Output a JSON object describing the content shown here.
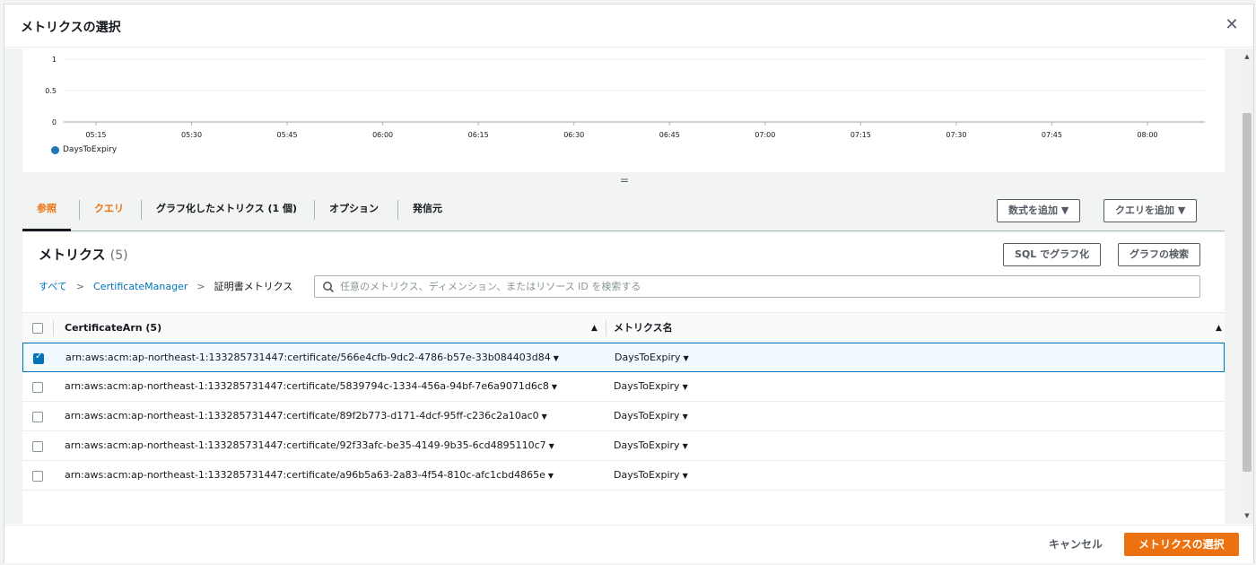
{
  "modal": {
    "title": "メトリクスの選択",
    "close_icon": "close-icon"
  },
  "chart_data": {
    "type": "line",
    "y_ticks": [
      "1",
      "0.5",
      "0"
    ],
    "ylim": [
      0,
      1
    ],
    "x_ticks": [
      "05:15",
      "05:30",
      "05:45",
      "06:00",
      "06:15",
      "06:30",
      "06:45",
      "07:00",
      "07:15",
      "07:30",
      "07:45",
      "08:00"
    ],
    "series": [
      {
        "name": "DaysToExpiry",
        "values": [],
        "color": "#1f77b4"
      }
    ],
    "grid": true,
    "legend": "bottom-left"
  },
  "resize_handle": "=",
  "tabs": [
    {
      "label": "参照",
      "active": true
    },
    {
      "label": "クエリ"
    },
    {
      "label": "グラフ化したメトリクス (1 個)"
    },
    {
      "label": "オプション"
    },
    {
      "label": "発信元"
    }
  ],
  "toolbar": {
    "add_formula": "数式を追加 ▼",
    "add_query": "クエリを追加 ▼"
  },
  "metrics": {
    "title": "メトリクス",
    "count": "(5)",
    "sql_button": "SQL でグラフ化",
    "graph_search_button": "グラフの検索"
  },
  "breadcrumb": {
    "all": "すべて",
    "namespace": "CertificateManager",
    "current": "証明書メトリクス",
    "separator": ">"
  },
  "search": {
    "placeholder": "任意のメトリクス、ディメンション、またはリソース ID を検索する",
    "value": ""
  },
  "table": {
    "columns": [
      {
        "label": "CertificateArn (5)",
        "sort": "▲"
      },
      {
        "label": "メトリクス名",
        "sort": "▲"
      }
    ],
    "rows": [
      {
        "arn": "arn:aws:acm:ap-northeast-1:133285731447:certificate/566e4cfb-9dc2-4786-b57e-33b084403d84",
        "metric": "DaysToExpiry",
        "checked": true
      },
      {
        "arn": "arn:aws:acm:ap-northeast-1:133285731447:certificate/5839794c-1334-456a-94bf-7e6a9071d6c8",
        "metric": "DaysToExpiry",
        "checked": false
      },
      {
        "arn": "arn:aws:acm:ap-northeast-1:133285731447:certificate/89f2b773-d171-4dcf-95ff-c236c2a10ac0",
        "metric": "DaysToExpiry",
        "checked": false
      },
      {
        "arn": "arn:aws:acm:ap-northeast-1:133285731447:certificate/92f33afc-be35-4149-9b35-6cd4895110c7",
        "metric": "DaysToExpiry",
        "checked": false
      },
      {
        "arn": "arn:aws:acm:ap-northeast-1:133285731447:certificate/a96b5a63-2a83-4f54-810c-afc1cbd4865e",
        "metric": "DaysToExpiry",
        "checked": false
      }
    ],
    "caret": "▼"
  },
  "footer": {
    "cancel": "キャンセル",
    "confirm": "メトリクスの選択"
  },
  "colors": {
    "accent": "#ec7211",
    "link": "#0073bb",
    "series": "#1f77b4"
  }
}
